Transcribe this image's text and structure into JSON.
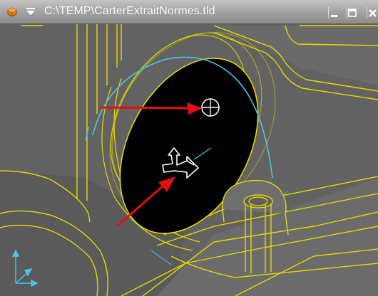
{
  "window": {
    "title": "C:\\TEMP\\CarterExtraitNormes.tld"
  },
  "icons": {
    "app": "app-cube-icon",
    "menu": "window-menu-caret-icon",
    "minimize": "minimize-icon",
    "maximize": "maximize-icon",
    "close": "close-icon",
    "cursor": "crosshair-cursor-icon",
    "manipulator": "move-manipulator-icon",
    "axes": "axis-triad-icon"
  },
  "colors": {
    "titlebar": "#a6a6a6",
    "viewport_background": "#5e5e5e",
    "wireframe_edges": "#e6d800",
    "selected_edge": "#44c8e8",
    "hole_fill": "#000000",
    "annotation_arrows": "#e01010",
    "axis_triad": "#44c8e8"
  }
}
